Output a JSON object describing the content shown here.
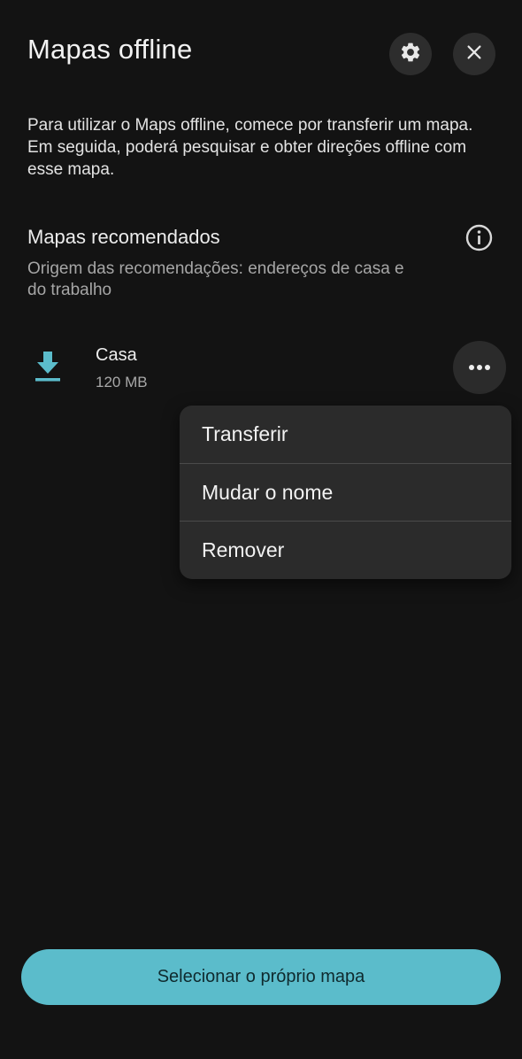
{
  "header": {
    "title": "Mapas offline",
    "settings_icon": "gear-icon",
    "close_icon": "close-icon"
  },
  "intro": {
    "text": "Para utilizar o Maps offline, comece por transferir um mapa. Em seguida, poderá pesquisar e obter direções offline com esse mapa."
  },
  "recommended": {
    "title": "Mapas recomendados",
    "subtitle": "Origem das recomendações: endereços de casa e do trabalho",
    "info_icon": "info-icon"
  },
  "map_item": {
    "name": "Casa",
    "size": "120 MB",
    "icon": "download-icon",
    "more_icon": "more-horizontal-icon"
  },
  "menu": {
    "items": [
      {
        "label": "Transferir"
      },
      {
        "label": "Mudar o nome"
      },
      {
        "label": "Remover"
      }
    ]
  },
  "footer": {
    "button_label": "Selecionar o próprio mapa"
  },
  "colors": {
    "background": "#131313",
    "accent": "#5bbccb",
    "surface": "#2b2b2b"
  }
}
